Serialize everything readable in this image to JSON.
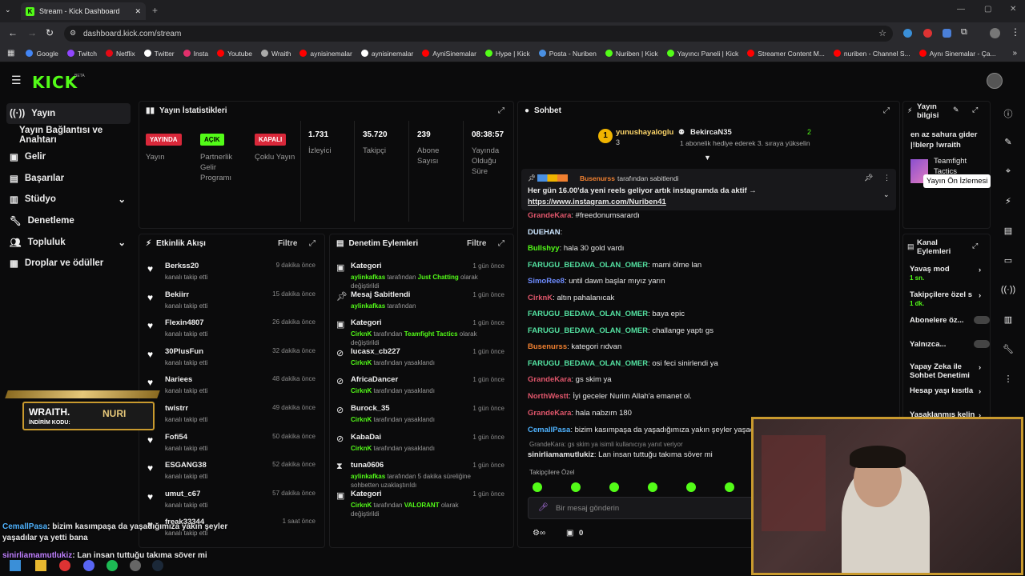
{
  "browser": {
    "tab_title": "Stream - Kick Dashboard",
    "url": "dashboard.kick.com/stream",
    "bookmarks": [
      "Google",
      "Twitch",
      "Netflix",
      "Twitter",
      "Insta",
      "Youtube",
      "Wraith",
      "aynisinemalar",
      "aynisinemalar",
      "AyniSinemalar",
      "Hype | Kick",
      "Posta - Nuriben",
      "Nuriben | Kick",
      "Yayıncı Paneli | Kick",
      "Streamer Content M...",
      "nuriben - Channel S...",
      "Aynı Sinemalar - Ça..."
    ]
  },
  "brand": {
    "logo": "KICK",
    "beta": "BETA",
    "accent": "#53fc18"
  },
  "sidebar": {
    "items": [
      {
        "label": "Yayın"
      },
      {
        "label": "Yayın Bağlantısı ve Anahtarı"
      },
      {
        "label": "Gelir"
      },
      {
        "label": "Başarılar"
      },
      {
        "label": "Stüdyo"
      },
      {
        "label": "Denetleme"
      },
      {
        "label": "Topluluk"
      },
      {
        "label": "Droplar ve ödüller"
      }
    ]
  },
  "stats": {
    "title": "Yayın İstatistikleri",
    "badges": [
      {
        "badge": "YAYINDA",
        "label": "Yayın"
      },
      {
        "badge": "AÇIK",
        "label": "Partnerlik Gelir Programı"
      },
      {
        "badge": "KAPALI",
        "label": "Çoklu Yayın"
      }
    ],
    "values": [
      {
        "value": "1.731",
        "label": "İzleyici"
      },
      {
        "value": "35.720",
        "label": "Takipçi"
      },
      {
        "value": "239",
        "label": "Abone Sayısı"
      },
      {
        "value": "08:38:57",
        "label": "Yayında Olduğu Süre"
      }
    ]
  },
  "activity": {
    "title": "Etkinlik Akışı",
    "filter": "Filtre",
    "sub": "kanalı takip etti",
    "items": [
      {
        "name": "Berkss20",
        "time": "9 dakika önce"
      },
      {
        "name": "Bekiirr",
        "time": "15 dakika önce"
      },
      {
        "name": "Flexin4807",
        "time": "26 dakika önce"
      },
      {
        "name": "30PlusFun",
        "time": "32 dakika önce"
      },
      {
        "name": "Nariees",
        "time": "48 dakika önce"
      },
      {
        "name": "twistrr",
        "time": "49 dakika önce"
      },
      {
        "name": "Fofi54",
        "time": "50 dakika önce"
      },
      {
        "name": "ESGANG38",
        "time": "52 dakika önce"
      },
      {
        "name": "umut_c67",
        "time": "57 dakika önce"
      },
      {
        "name": "freak33344",
        "time": "1 saat önce"
      }
    ]
  },
  "modlog": {
    "title": "Denetim Eylemleri",
    "filter": "Filtre",
    "items": [
      {
        "title": "Kategori",
        "time": "1 gün önce",
        "actor": "aylinkafkas",
        "text": "tarafından",
        "hl": "Just Chatting",
        "rest": "olarak değiştirildi"
      },
      {
        "title": "Mesaj Sabitlendi",
        "time": "1 gün önce",
        "actor": "aylinkafkas",
        "text": "tarafından",
        "hl": "",
        "rest": ""
      },
      {
        "title": "Kategori",
        "time": "1 gün önce",
        "actor": "CirknK",
        "text": "tarafından",
        "hl": "Teamfight Tactics",
        "rest": "olarak değiştirildi"
      },
      {
        "title": "lucasx_cb227",
        "time": "1 gün önce",
        "actor": "CirknK",
        "text": "tarafından yasaklandı",
        "hl": "",
        "rest": ""
      },
      {
        "title": "AfricaDancer",
        "time": "1 gün önce",
        "actor": "CirknK",
        "text": "tarafından yasaklandı",
        "hl": "",
        "rest": ""
      },
      {
        "title": "Burock_35",
        "time": "1 gün önce",
        "actor": "CirknK",
        "text": "tarafından yasaklandı",
        "hl": "",
        "rest": ""
      },
      {
        "title": "KabaDai",
        "time": "1 gün önce",
        "actor": "CirknK",
        "text": "tarafından yasaklandı",
        "hl": "",
        "rest": ""
      },
      {
        "title": "tuna0606",
        "time": "1 gün önce",
        "actor": "aylinkafkas",
        "text": "tarafından 5 dakika süreliğine sohbetten uzaklaştırıldı",
        "hl": "",
        "rest": ""
      },
      {
        "title": "Kategori",
        "time": "1 gün önce",
        "actor": "CirknK",
        "text": "tarafından",
        "hl": "VALORANT",
        "rest": "olarak değiştirildi"
      }
    ]
  },
  "chat": {
    "title": "Sohbet",
    "top": {
      "user1": "yunushayaloglu",
      "count1": "3",
      "user2": "BekircaN35",
      "count2": "2",
      "gift_text": "1 abonelik hediye ederek 3. sıraya yükselin"
    },
    "pinned": {
      "by": "Busenurss",
      "by_text": "tarafından sabitlendi",
      "text": "Her gün 16.00'da yeni reels geliyor artık instagramda da aktif →",
      "link": "https://www.instagram.com/Nuriben41"
    },
    "messages": [
      {
        "user": "GrandeKara",
        "color": "#e0566b",
        "text": "#freedonumsarardı"
      },
      {
        "user": "DUEHAN",
        "color": "#cce6ff",
        "text": ""
      },
      {
        "user": "Bullshyy",
        "color": "#53fc18",
        "text": "hala 30 gold vardı"
      },
      {
        "user": "FARUGU_BEDAVA_OLAN_OMER",
        "color": "#53e0a0",
        "text": "mami ölme lan"
      },
      {
        "user": "SimoRee8",
        "color": "#6e8cff",
        "text": "until dawn başlar mıyız yarın"
      },
      {
        "user": "CirknK",
        "color": "#e0566b",
        "text": "altın pahalanıcak"
      },
      {
        "user": "FARUGU_BEDAVA_OLAN_OMER",
        "color": "#53e0a0",
        "text": "baya epic"
      },
      {
        "user": "FARUGU_BEDAVA_OLAN_OMER",
        "color": "#53e0a0",
        "text": "challange yaptı gs"
      },
      {
        "user": "Busenurss",
        "color": "#f08030",
        "text": "kategori rıdvan"
      },
      {
        "user": "FARUGU_BEDAVA_OLAN_OMER",
        "color": "#53e0a0",
        "text": "osi feci sinirlendi ya"
      },
      {
        "user": "GrandeKara",
        "color": "#e0566b",
        "text": "gs skim ya"
      },
      {
        "user": "NorthWestt",
        "color": "#e0566b",
        "text": "İyi geceler Nurim Allah'a emanet ol."
      },
      {
        "user": "GrandeKara",
        "color": "#e0566b",
        "text": "hala nabzım 180"
      },
      {
        "user": "CemallPasa",
        "color": "#4fb3ff",
        "text": "bizim kasımpaşa da yaşadığımıza yakın şeyler yaşadıla"
      },
      {
        "user": "sinirliamamutlukiz",
        "color": "#e8e8e8",
        "text": "Lan insan tuttuğu takıma söver mi"
      }
    ],
    "reply_to": "GrandeKara: gs skim ya isimli kullanıcıya yanıt veriyor",
    "followers_only": "Takipçilere Özel",
    "placeholder": "Bir mesaj gönderin",
    "footer_count": "0"
  },
  "info": {
    "title": "Yayın bilgisi",
    "stream_title": "en az sahura gider |!blerp !wraith",
    "category": "Teamfight Tactics",
    "tooltip": "Yayın Ön İzlemesi"
  },
  "channel": {
    "title": "Kanal Eylemleri",
    "items": [
      {
        "label": "Yavaş mod",
        "sub": "1 sn."
      },
      {
        "label": "Takipçilere özel s",
        "sub": "1 dk."
      },
      {
        "label": "Abonelere öz...",
        "sub": ""
      },
      {
        "label": "Yalnızca...",
        "sub": ""
      },
      {
        "label": "Yapay Zeka ile Sohbet Denetimi",
        "sub": ""
      },
      {
        "label": "Hesap yaşı kısıtla",
        "sub": ""
      },
      {
        "label": "Yasaklanmış kelin",
        "sub": ""
      }
    ]
  },
  "overlay": {
    "wraith_title": "WRAITH.",
    "wraith_name": "NURI",
    "wraith_code": "İNDİRİM KODU:",
    "chat1_user": "CemallPasa",
    "chat1_text": ": bizim kasımpaşa da yaşadığımıza yakın şeyler yaşadılar ya yetti bana",
    "chat2_user": "sinirliamamutlukiz",
    "chat2_text": ": Lan insan tuttuğu takıma söver mi"
  }
}
